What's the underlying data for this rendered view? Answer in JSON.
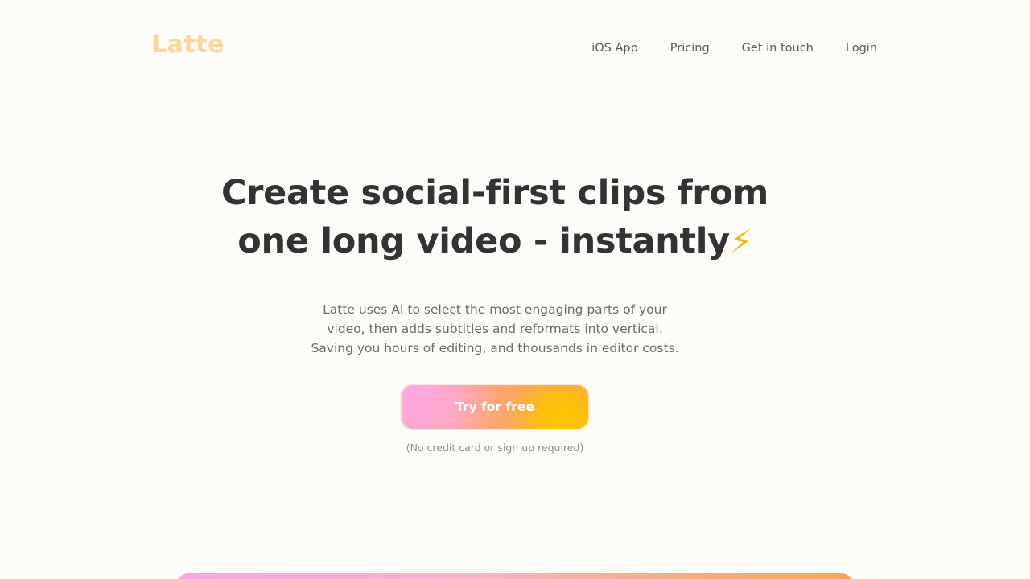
{
  "brand": {
    "logo_text": "Latte",
    "logo_color": "#fcd79c"
  },
  "nav": {
    "links": [
      {
        "label": "iOS App"
      },
      {
        "label": "Pricing"
      },
      {
        "label": "Get in touch"
      },
      {
        "label": "Login"
      }
    ]
  },
  "hero": {
    "headline_line1": "Create social-first clips from",
    "headline_line2": "one long video - instantly",
    "headline_icon": "⚡",
    "subtitle_line1": "Latte uses AI to select the most engaging parts of your",
    "subtitle_line2": "video, then adds subtitles and reformats into vertical.",
    "subtitle_line3": "Saving you hours of editing, and thousands in editor costs."
  },
  "cta": {
    "label": "Try for free",
    "note": "(No credit card or sign up required)"
  },
  "colors": {
    "background": "#fefcf8",
    "text": "#333333",
    "cta_pink": "#ffa7e4",
    "cta_orange": "#fda66a",
    "cta_yellow": "#ffc400"
  }
}
